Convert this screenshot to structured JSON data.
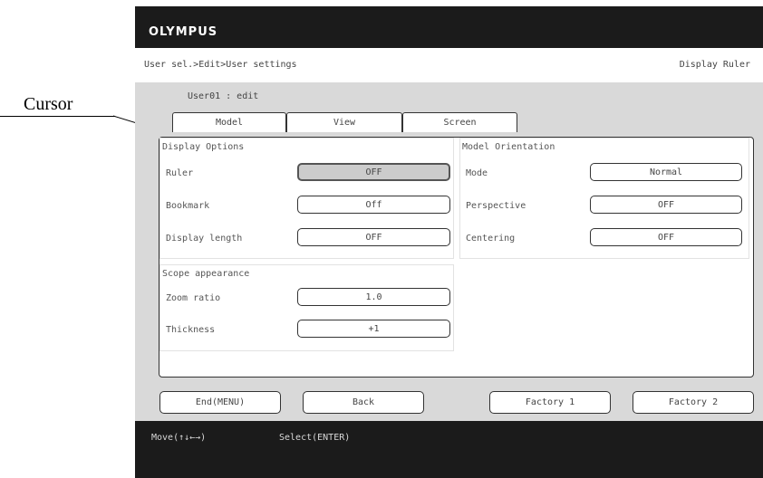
{
  "brand": "OLYMPUS",
  "breadcrumb": "User sel.>Edit>User settings",
  "screen_name": "Display Ruler",
  "mode_label": "User01 : edit",
  "tabs": [
    {
      "label": "Model"
    },
    {
      "label": "View"
    },
    {
      "label": "Screen"
    }
  ],
  "display_options": {
    "title": "Display Options",
    "rows": [
      {
        "label": "Ruler",
        "value": "OFF",
        "selected": true
      },
      {
        "label": "Bookmark",
        "value": "Off",
        "selected": false
      },
      {
        "label": "Display length",
        "value": "OFF",
        "selected": false
      }
    ]
  },
  "model_orientation": {
    "title": "Model Orientation",
    "rows": [
      {
        "label": "Mode",
        "value": "Normal"
      },
      {
        "label": "Perspective",
        "value": "OFF"
      },
      {
        "label": "Centering",
        "value": "OFF"
      }
    ]
  },
  "scope_appearance": {
    "title": "Scope appearance",
    "rows": [
      {
        "label": "Zoom ratio",
        "value": "1.0"
      },
      {
        "label": "Thickness",
        "value": "+1"
      }
    ]
  },
  "footer_buttons": {
    "end": "End(MENU)",
    "back": "Back",
    "factory1": "Factory 1",
    "factory2": "Factory 2"
  },
  "status_hints": {
    "move": "Move(↑↓←→)",
    "select": "Select(ENTER)"
  },
  "callout": "Cursor",
  "colors": {
    "bar_dark": "#1b1b1b",
    "content_gray": "#d9d9d9",
    "selected_fill": "#cccccc"
  }
}
